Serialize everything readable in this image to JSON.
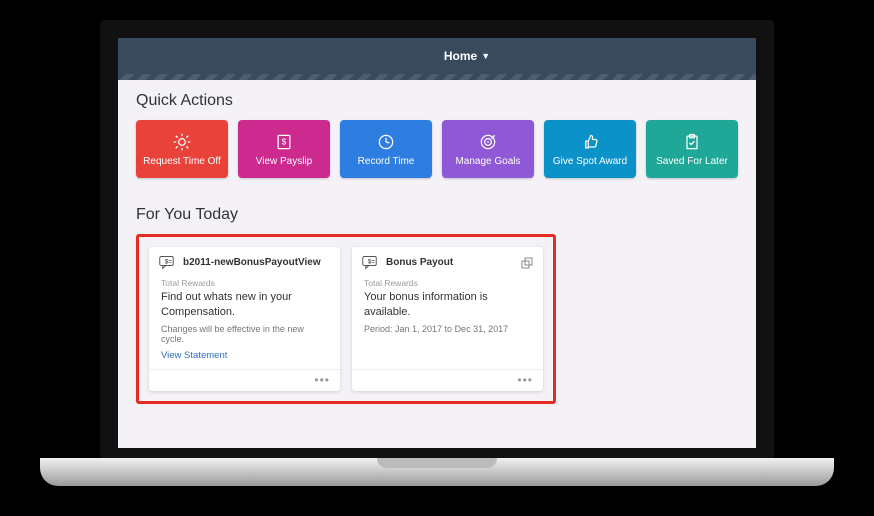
{
  "nav": {
    "home_label": "Home"
  },
  "quick": {
    "title": "Quick Actions",
    "tiles": [
      {
        "label": "Request Time Off"
      },
      {
        "label": "View Payslip"
      },
      {
        "label": "Record Time"
      },
      {
        "label": "Manage Goals"
      },
      {
        "label": "Give Spot Award"
      },
      {
        "label": "Saved For Later"
      }
    ]
  },
  "foryou": {
    "title": "For You Today",
    "cards": [
      {
        "header": "b2011-newBonusPayoutView",
        "category": "Total Rewards",
        "title": "Find out whats new in your Compensation.",
        "subtitle": "Changes will be effective in the new cycle.",
        "link": "View Statement"
      },
      {
        "header": "Bonus Payout",
        "category": "Total Rewards",
        "title": "Your bonus information is available.",
        "subtitle": "Period: Jan 1, 2017 to Dec 31, 2017"
      }
    ]
  }
}
